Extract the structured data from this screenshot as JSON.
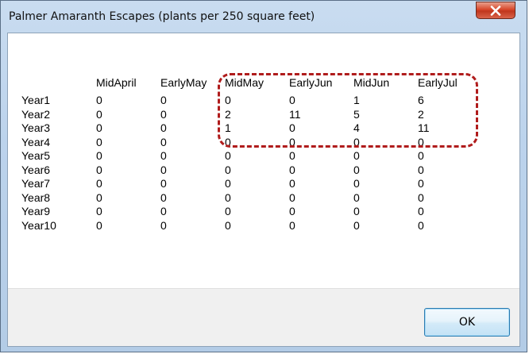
{
  "window": {
    "title": "Palmer Amaranth Escapes (plants per 250 square feet)",
    "close_label": "x"
  },
  "table": {
    "columns": [
      "MidApril",
      "EarlyMay",
      "MidMay",
      "EarlyJun",
      "MidJun",
      "EarlyJul"
    ],
    "rows": [
      {
        "label": "Year1",
        "values": [
          "0",
          "0",
          "0",
          "0",
          "1",
          "6"
        ]
      },
      {
        "label": "Year2",
        "values": [
          "0",
          "0",
          "2",
          "11",
          "5",
          "2"
        ]
      },
      {
        "label": "Year3",
        "values": [
          "0",
          "0",
          "1",
          "0",
          "4",
          "11"
        ]
      },
      {
        "label": "Year4",
        "values": [
          "0",
          "0",
          "0",
          "0",
          "0",
          "0"
        ]
      },
      {
        "label": "Year5",
        "values": [
          "0",
          "0",
          "0",
          "0",
          "0",
          "0"
        ]
      },
      {
        "label": "Year6",
        "values": [
          "0",
          "0",
          "0",
          "0",
          "0",
          "0"
        ]
      },
      {
        "label": "Year7",
        "values": [
          "0",
          "0",
          "0",
          "0",
          "0",
          "0"
        ]
      },
      {
        "label": "Year8",
        "values": [
          "0",
          "0",
          "0",
          "0",
          "0",
          "0"
        ]
      },
      {
        "label": "Year9",
        "values": [
          "0",
          "0",
          "0",
          "0",
          "0",
          "0"
        ]
      },
      {
        "label": "Year10",
        "values": [
          "0",
          "0",
          "0",
          "0",
          "0",
          "0"
        ]
      }
    ]
  },
  "buttons": {
    "ok_label": "OK"
  },
  "colors": {
    "highlight": "#b01c1c",
    "close_button": "#d8472b"
  }
}
